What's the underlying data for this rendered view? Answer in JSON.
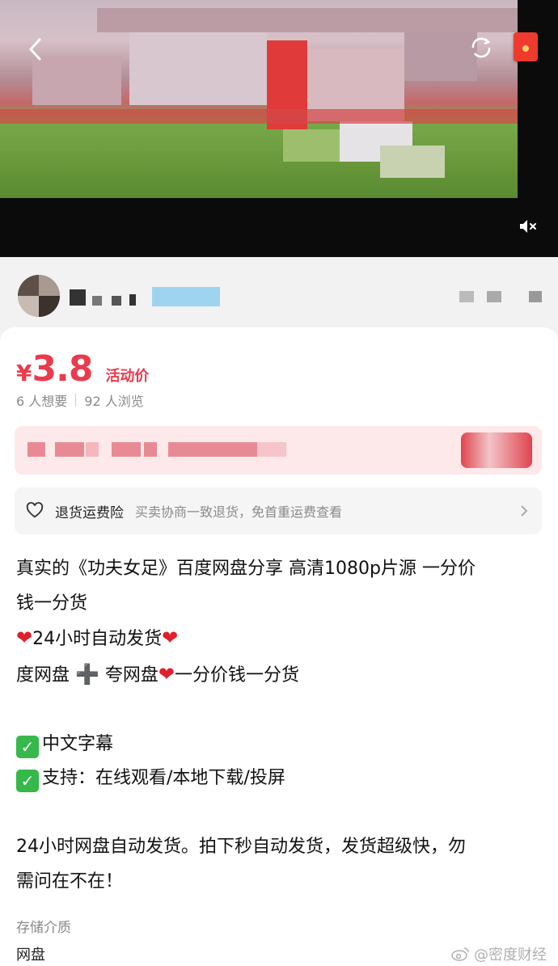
{
  "video": {
    "back_icon": "chevron-left-icon",
    "refresh_icon": "refresh-icon",
    "red_packet_icon": "red-packet-icon",
    "mute_icon": "speaker-muted-icon"
  },
  "seller": {
    "avatar_icon": "avatar-image",
    "more_icon": "more-icon"
  },
  "product": {
    "currency": "¥",
    "price": "3.8",
    "price_tag": "活动价",
    "wants": "6 人想要",
    "views": "92 人浏览",
    "accent_color": "#ea3b4c"
  },
  "insurance": {
    "title": "退货运费险",
    "desc": "买卖协商一致退货，免首重运费查看",
    "icon": "heart-outline-icon"
  },
  "description": {
    "line1": "真实的《功夫女足》百度网盘分享  高清1080p片源  一分价",
    "line2": "钱一分货",
    "line3_text": "24小时自动发货",
    "line4_a": "度网盘",
    "line4_b": "夸网盘",
    "line4_c": "一分价钱一分货",
    "line6_text": "中文字幕",
    "line7_text": "支持：在线观看/本地下载/投屏",
    "line9": "24小时网盘自动发货。拍下秒自动发货，发货超级快，勿",
    "line10": "需问在不在！"
  },
  "meta": {
    "storage_label": "存储介质",
    "storage_value": "网盘"
  },
  "watermark": {
    "text": "@密度财经"
  }
}
